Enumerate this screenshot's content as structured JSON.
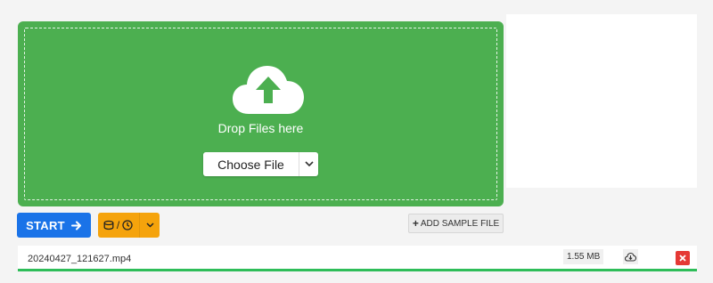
{
  "dropzone": {
    "upload_icon": "cloud-upload-icon",
    "text": "Drop Files here",
    "choose_label": "Choose File",
    "dropdown_icon": "chevron-down-icon",
    "bg_color": "#4caf50"
  },
  "toolbar": {
    "start_label": "START",
    "start_icon": "arrow-right-icon",
    "start_color": "#1a73e8",
    "options_icons": [
      "database-icon",
      "clock-icon",
      "chevron-down-icon"
    ],
    "options_separator": "/",
    "options_color": "#f5a30c",
    "sample_label": "ADD SAMPLE FILE"
  },
  "files": [
    {
      "name": "20240427_121627.mp4",
      "size": "1.55 MB",
      "progress": 1.0,
      "progress_color": "#2ebd59"
    }
  ]
}
